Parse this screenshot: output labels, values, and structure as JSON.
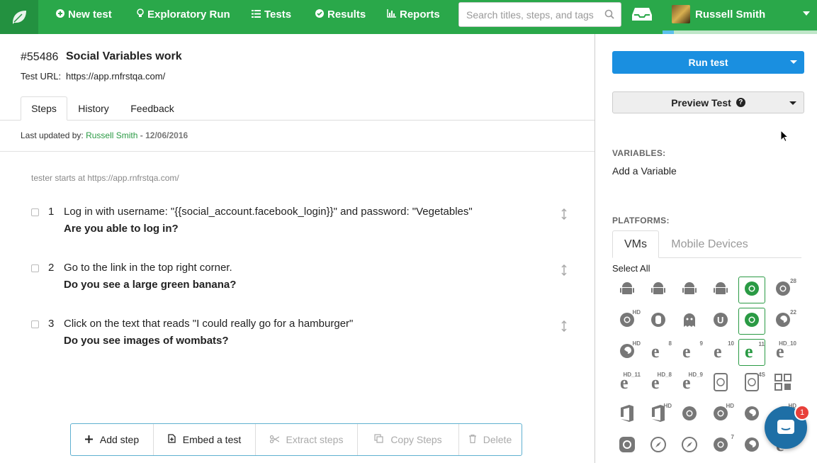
{
  "nav": {
    "items": [
      {
        "label": "New test",
        "icon": "plus-circle-icon"
      },
      {
        "label": "Exploratory Run",
        "icon": "bulb-icon"
      },
      {
        "label": "Tests",
        "icon": "list-icon"
      },
      {
        "label": "Results",
        "icon": "check-circle-icon"
      },
      {
        "label": "Reports",
        "icon": "bar-chart-icon"
      }
    ],
    "search_placeholder": "Search titles, steps, and tags",
    "user_name": "Russell Smith"
  },
  "test": {
    "id": "#55486",
    "title": "Social Variables work",
    "url_label": "Test URL:",
    "url": "https://app.rnfrstqa.com/"
  },
  "tabs": [
    "Steps",
    "History",
    "Feedback"
  ],
  "last_updated": {
    "label": "Last updated by:",
    "user": "Russell Smith",
    "date": " - 12/06/2016"
  },
  "start_note": "tester starts at https://app.rnfrstqa.com/",
  "steps": [
    {
      "num": "1",
      "action": "Log in with username: \"{{social_account.facebook_login}}\" and password: \"Vegetables\"",
      "expected": "Are you able to log in?"
    },
    {
      "num": "2",
      "action": "Go to the link in the top right corner.",
      "expected": "Do you see a large green banana?"
    },
    {
      "num": "3",
      "action": "Click on the text that reads \"I could really go for a hamburger\"",
      "expected": "Do you see images of wombats?"
    }
  ],
  "action_bar": [
    {
      "label": "Add step",
      "icon": "plus-icon",
      "enabled": true
    },
    {
      "label": "Embed a test",
      "icon": "embed-doc-icon",
      "enabled": true
    },
    {
      "label": "Extract steps",
      "icon": "scissors-icon",
      "enabled": false
    },
    {
      "label": "Copy Steps",
      "icon": "copy-icon",
      "enabled": false
    },
    {
      "label": "Delete",
      "icon": "trash-icon",
      "enabled": false
    }
  ],
  "sidebar": {
    "run_label": "Run test",
    "preview_label": "Preview Test",
    "variables_heading": "VARIABLES:",
    "add_variable": "Add a Variable",
    "platforms_heading": "PLATFORMS:",
    "platform_tabs": [
      "VMs",
      "Mobile Devices"
    ],
    "select_all": "Select All",
    "platform_sups": {
      "r0c5": "28",
      "r1c0": "HD",
      "r1c5": "22",
      "r2c0": "HD",
      "r2c1": "8",
      "r2c2": "9",
      "r2c3": "10",
      "r2c4": "11",
      "r2c5": "HD_10",
      "r3c0": "HD_11",
      "r3c1": "HD_8",
      "r3c2": "HD_9",
      "r3c4": "4S",
      "r4c1": "HD",
      "r4c3": "HD",
      "r4c5": "HD",
      "r5c3": "7"
    }
  },
  "chat_badge": "1",
  "colors": {
    "brand": "#2aa84a",
    "run": "#1a8fe0",
    "chat": "#1e6fa6",
    "badge": "#e8403a"
  }
}
